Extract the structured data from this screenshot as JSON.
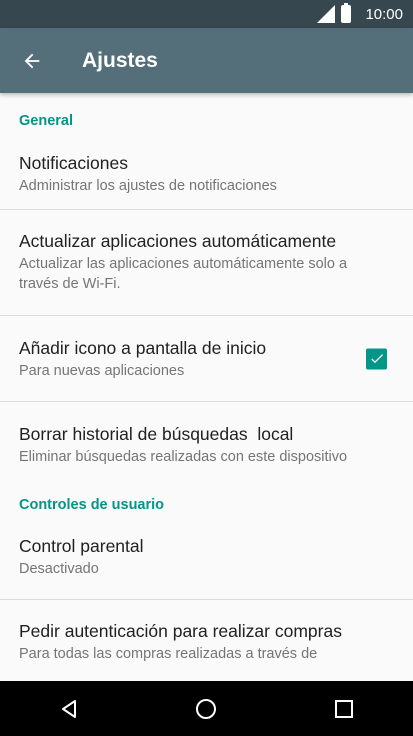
{
  "status_bar": {
    "time": "10:00",
    "icons": [
      "signal-icon",
      "battery-icon"
    ]
  },
  "app_bar": {
    "title": "Ajustes",
    "back_icon": "arrow-back-icon"
  },
  "sections": {
    "general": {
      "header": "General",
      "notifications": {
        "title": "Notificaciones",
        "subtitle": "Administrar los ajustes de notificaciones"
      },
      "auto_update": {
        "title": "Actualizar aplicaciones automáticamente",
        "subtitle_line1": "Actualizar las aplicaciones automáticamente solo a",
        "subtitle_line2": "través de Wi-Fi."
      },
      "add_icon": {
        "title": "Añadir icono a pantalla de inicio",
        "subtitle": "Para nuevas aplicaciones",
        "checked": true
      },
      "clear_history": {
        "title": "Borrar historial de búsquedas  local",
        "subtitle": "Eliminar búsquedas realizadas con este dispositivo"
      }
    },
    "user_controls": {
      "header": "Controles de usuario",
      "parental": {
        "title": "Control parental",
        "subtitle": "Desactivado"
      },
      "purchase_auth": {
        "title": "Pedir autenticación para realizar compras",
        "subtitle": "Para todas las compras realizadas a través de"
      }
    }
  },
  "nav_bar": {
    "icons": [
      "back-triangle-icon",
      "home-circle-icon",
      "recents-square-icon"
    ]
  },
  "colors": {
    "status_bar": "#37474f",
    "app_bar": "#546e7a",
    "accent": "#009688",
    "background": "#fafafa"
  }
}
